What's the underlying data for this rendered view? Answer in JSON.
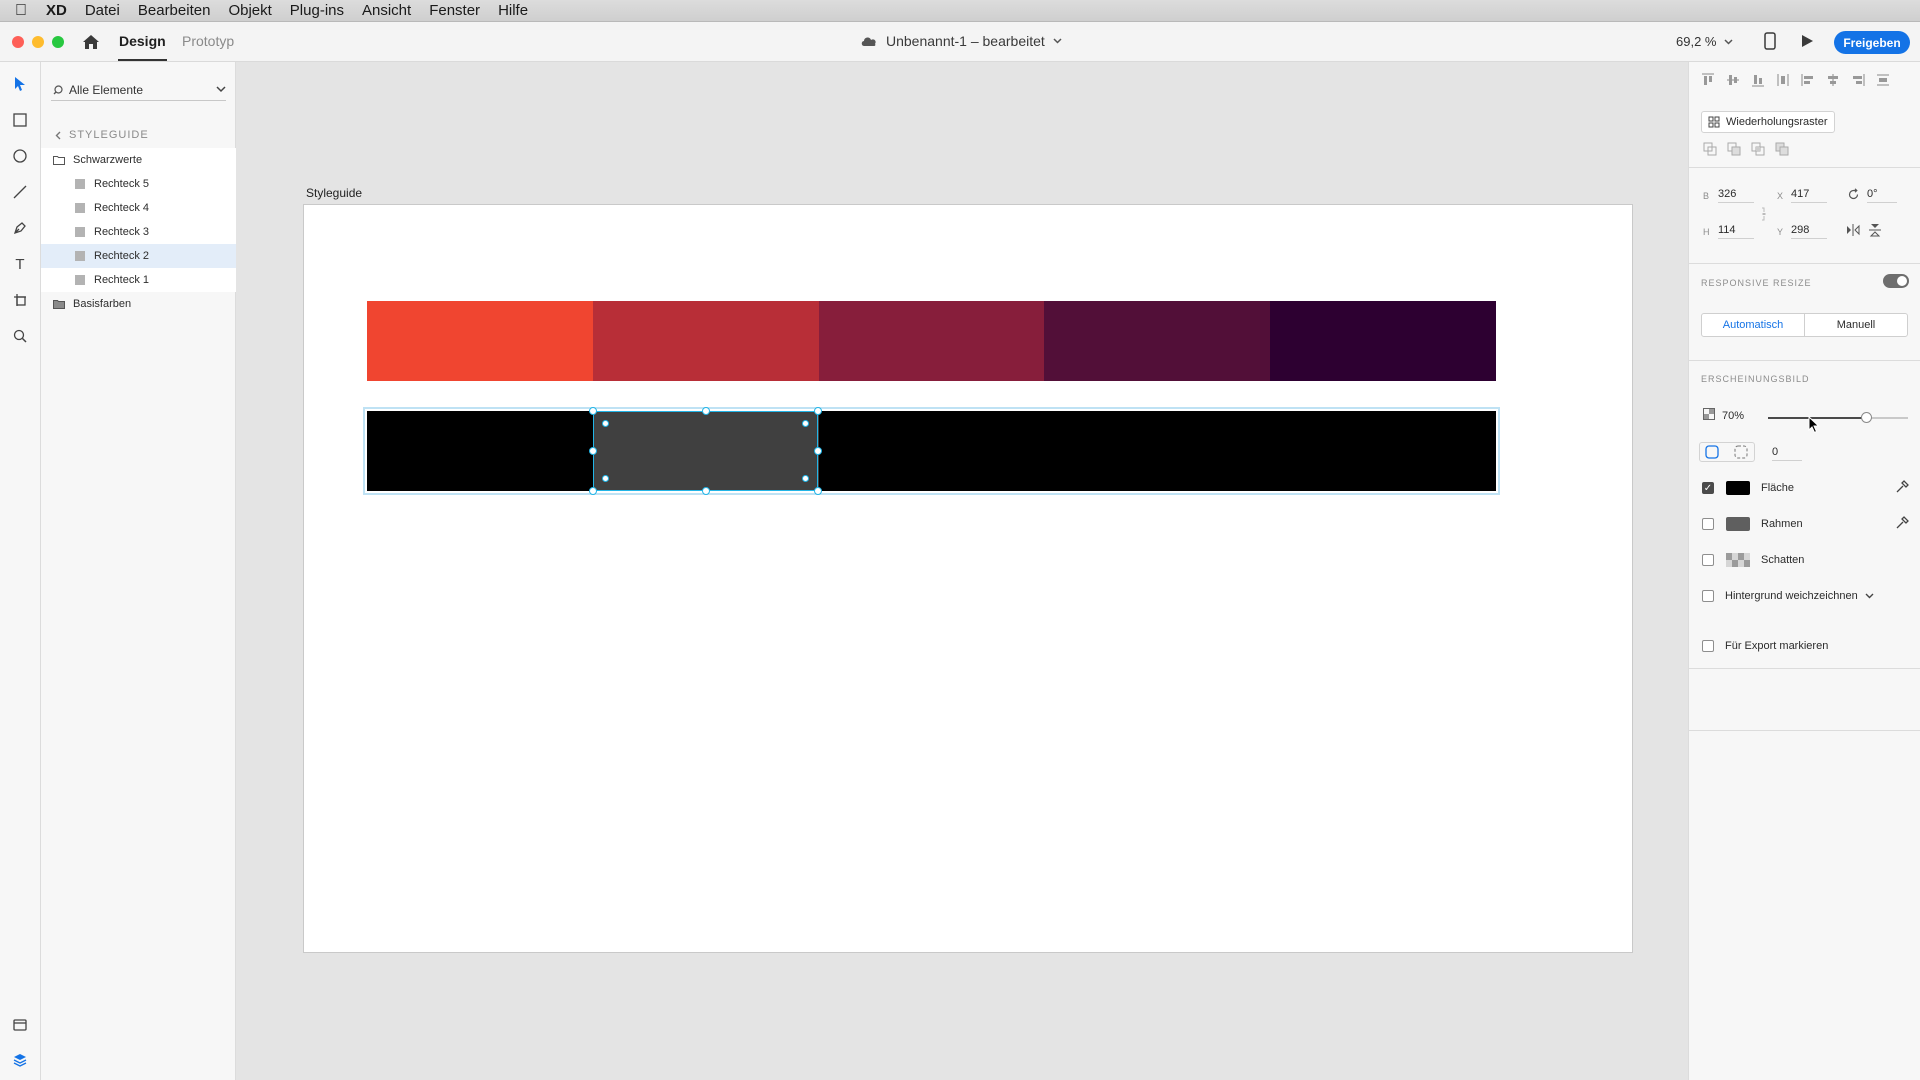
{
  "menubar": {
    "app": "XD",
    "items": [
      "Datei",
      "Bearbeiten",
      "Objekt",
      "Plug-ins",
      "Ansicht",
      "Fenster",
      "Hilfe"
    ]
  },
  "titlebar": {
    "tab_design": "Design",
    "tab_prototype": "Prototyp",
    "doc_title": "Unbenannt-1 – bearbeitet",
    "zoom": "69,2 %",
    "share_label": "Freigeben"
  },
  "layers": {
    "search_label": "Alle Elemente",
    "breadcrumb": "STYLEGUIDE",
    "group_black": "Schwarzwerte",
    "items": [
      "Rechteck 5",
      "Rechteck 4",
      "Rechteck 3",
      "Rechteck 2",
      "Rechteck 1"
    ],
    "selected_item": "Rechteck 2",
    "group_base": "Basisfarben"
  },
  "canvas": {
    "artboard_label": "Styleguide",
    "color_swatches": [
      "#f04530",
      "#b82e37",
      "#871e3b",
      "#520f38",
      "#2d0031"
    ],
    "black_swatches": [
      "#000000",
      "#404040",
      "#000000",
      "#000000",
      "#000000"
    ]
  },
  "properties": {
    "repeat_grid": "Wiederholungsraster",
    "width_label": "B",
    "width": "326",
    "height_label": "H",
    "height": "114",
    "x_label": "X",
    "x": "417",
    "y_label": "Y",
    "y": "298",
    "rotation": "0°",
    "responsive_title": "RESPONSIVE RESIZE",
    "responsive_on": true,
    "seg_auto": "Automatisch",
    "seg_manual": "Manuell",
    "appearance_title": "ERSCHEINUNGSBILD",
    "opacity": "70%",
    "opacity_value": 0.7,
    "corner_radius": "0",
    "fill_label": "Fläche",
    "fill_color": "#000000",
    "fill_checked": true,
    "border_label": "Rahmen",
    "border_color": "#5f5f5f",
    "border_checked": false,
    "shadow_label": "Schatten",
    "shadow_checked": false,
    "bg_blur_label": "Hintergrund weichzeichnen",
    "bg_blur_checked": false,
    "export_label": "Für Export markieren",
    "export_checked": false
  },
  "colors": {
    "accent": "#1473e6",
    "selection": "#22b5e7"
  }
}
